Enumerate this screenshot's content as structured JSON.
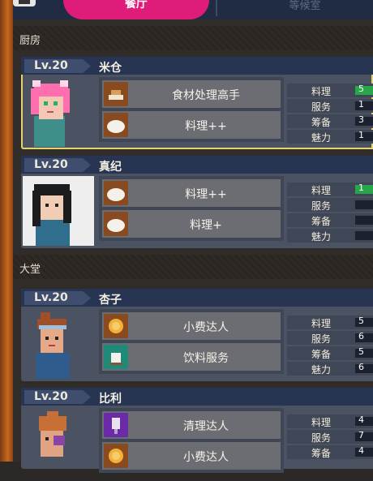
{
  "tabs": {
    "active": "餐厅",
    "inactive": "等候室"
  },
  "sections": {
    "kitchen": "厨房",
    "hall": "大堂"
  },
  "stat_labels": [
    "料理",
    "服务",
    "筹备",
    "魅力"
  ],
  "staff": [
    {
      "level": "Lv.20",
      "name": "米仓",
      "skills": [
        "食材处理高手",
        "料理++"
      ],
      "stat_values": [
        "5",
        "1",
        "3",
        "1"
      ]
    },
    {
      "level": "Lv.20",
      "name": "真纪",
      "skills": [
        "料理++",
        "料理+"
      ],
      "stat_values": [
        "1",
        "",
        "",
        ""
      ]
    },
    {
      "level": "Lv.20",
      "name": "杏子",
      "skills": [
        "小费达人",
        "饮料服务"
      ],
      "stat_values": [
        "5",
        "6",
        "5",
        "6"
      ]
    },
    {
      "level": "Lv.20",
      "name": "比利",
      "skills": [
        "清理达人",
        "小费达人"
      ],
      "stat_values": [
        "4",
        "7",
        "4",
        ""
      ]
    }
  ],
  "colors": {
    "tab_active": "#e01c7a",
    "card_head": "#283552",
    "selected_outline": "#e8d36a"
  }
}
